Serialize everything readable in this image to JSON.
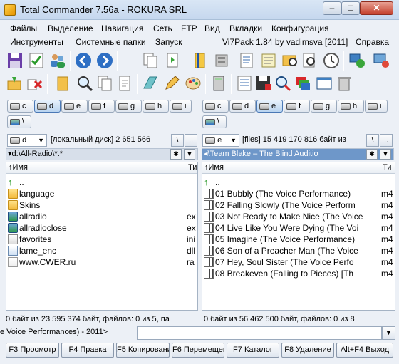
{
  "window": {
    "title": "Total Commander 7.56a - ROKURA SRL",
    "min_label": "–",
    "max_label": "□",
    "close_label": "✕"
  },
  "menu1": [
    "Файлы",
    "Выделение",
    "Навигация",
    "Сеть",
    "FTP",
    "Вид",
    "Вкладки",
    "Конфигурация"
  ],
  "menu2": {
    "items": [
      "Инструменты",
      "Системные папки",
      "Запуск"
    ],
    "pack": "Vi7Pack 1.84 by vadimsva  [2011]",
    "help": "Справка"
  },
  "toolbar_icons": {
    "row1": [
      "floppy-save-icon",
      "check-list-icon",
      "users-icon",
      "back-arrow-icon",
      "forward-arrow-icon",
      "copy-pages-icon",
      "paste-pages-icon",
      "bookmark-icon",
      "database-icon",
      "edit-doc-icon",
      "folder-search-icon",
      "clock-icon",
      "blank-doc-icon",
      "network-globe-icon",
      "monitor-sync-icon"
    ],
    "row2": [
      "user-pin-icon",
      "delete-x-icon",
      "folder-open-icon",
      "magnifier-icon",
      "notepad-icon",
      "pages-icon",
      "notebook-icon",
      "pen-icon",
      "palette-icon",
      "calculator-icon",
      "report-icon",
      "save-disk-icon",
      "zoom-icon",
      "windows-icon",
      "window-icon",
      "recycle-icon"
    ]
  },
  "left": {
    "drives": [
      "c",
      "d",
      "e",
      "f",
      "g",
      "h",
      "i"
    ],
    "active_drive": "d",
    "drive_combo": "d",
    "drive_info": "[локальный диск]  2 651 566",
    "backslash": "\\",
    "up": "..",
    "path": "▾d:\\All-Radio\\*.*",
    "col_name": "↑Имя",
    "col_ext": "Ти",
    "files": [
      {
        "icon": "up-arrow-icon",
        "name": "..",
        "ext": ""
      },
      {
        "icon": "folder-icon",
        "name": "language",
        "ext": ""
      },
      {
        "icon": "folder-icon",
        "name": "Skins",
        "ext": ""
      },
      {
        "icon": "app-icon",
        "name": "allradio",
        "ext": "ex"
      },
      {
        "icon": "app-icon",
        "name": "allradioclose",
        "ext": "ex"
      },
      {
        "icon": "settings-file-icon",
        "name": "favorites",
        "ext": "ini"
      },
      {
        "icon": "dll-icon",
        "name": "lame_enc",
        "ext": "dll"
      },
      {
        "icon": "link-file-icon",
        "name": "www.CWER.ru",
        "ext": "ra"
      }
    ],
    "status": "0 байт из 23 595 374 байт, файлов: 0 из 5, па"
  },
  "right": {
    "drives": [
      "c",
      "d",
      "e",
      "f",
      "g",
      "h",
      "i"
    ],
    "active_drive": "e",
    "drive_combo": "e",
    "drive_info": "[files]  15 419 170 816 байт из",
    "backslash": "\\",
    "up": "..",
    "path": "◂\\Team Blake – The Blind Auditio",
    "col_name": "↑Имя",
    "col_ext": "Ти",
    "files": [
      {
        "icon": "up-arrow-icon",
        "name": "..",
        "ext": ""
      },
      {
        "icon": "media-file-icon",
        "name": "01 Bubbly (The Voice Performance)",
        "ext": "m4"
      },
      {
        "icon": "media-file-icon",
        "name": "02 Falling Slowly (The Voice Perform",
        "ext": "m4"
      },
      {
        "icon": "media-file-icon",
        "name": "03 Not Ready to Make Nice (The Voice",
        "ext": "m4"
      },
      {
        "icon": "media-file-icon",
        "name": "04 Live Like You Were Dying (The Voi",
        "ext": "m4"
      },
      {
        "icon": "media-file-icon",
        "name": "05 Imagine (The Voice Performance)",
        "ext": "m4"
      },
      {
        "icon": "media-file-icon",
        "name": "06 Son of a Preacher Man (The Voice",
        "ext": "m4"
      },
      {
        "icon": "media-file-icon",
        "name": "07 Hey, Soul Sister (The Voice Perfo",
        "ext": "m4"
      },
      {
        "icon": "media-file-icon",
        "name": "08 Breakeven (Falling to Pieces) [Th",
        "ext": "m4"
      }
    ],
    "status": "0 байт из 56 462 500 байт, файлов: 0 из 8"
  },
  "cmdline": {
    "label": "e Voice Performances) - 2011>"
  },
  "fkeys": [
    "F3 Просмотр",
    "F4 Правка",
    "F5 Копирование",
    "F6 Перемещение",
    "F7 Каталог",
    "F8 Удаление",
    "Alt+F4 Выход"
  ]
}
